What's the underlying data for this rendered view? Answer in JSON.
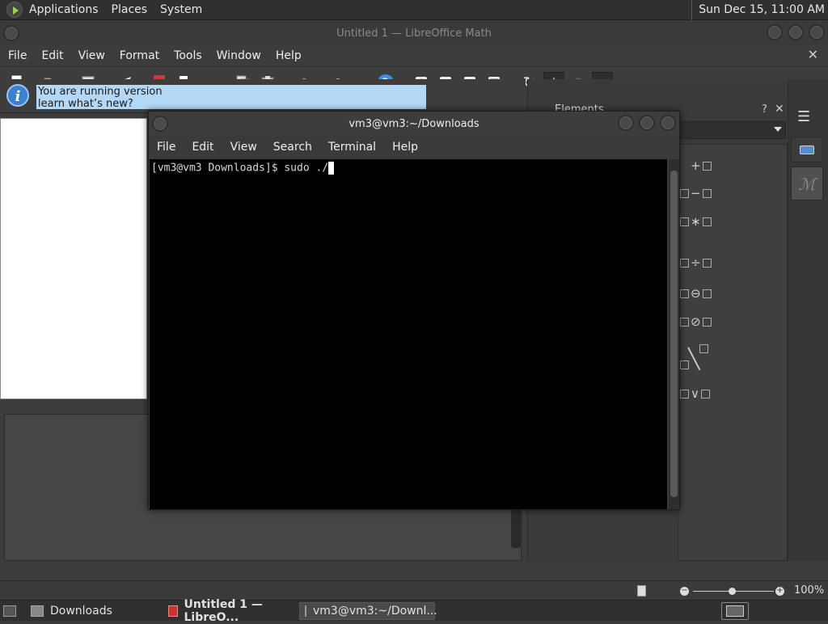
{
  "topbar": {
    "menus": [
      "Applications",
      "Places",
      "System"
    ],
    "clock": "Sun Dec 15, 11:00 AM"
  },
  "libreoffice": {
    "title": "Untitled 1 — LibreOffice Math",
    "menus": [
      "File",
      "Edit",
      "View",
      "Format",
      "Tools",
      "Window",
      "Help"
    ],
    "infobar_text_line1": "You are running version",
    "infobar_text_line2": "learn what’s new?",
    "sidebar": {
      "title": "Elements"
    },
    "zoom": "100%",
    "zoom_level_percent": 100
  },
  "elements": [
    {
      "symbol": "+",
      "label": "plus"
    },
    {
      "symbol": "−",
      "label": "minus"
    },
    {
      "symbol": "∗",
      "label": "multiply"
    },
    {
      "symbol": "÷",
      "label": "divide"
    },
    {
      "symbol": "⊖",
      "label": "circled-minus"
    },
    {
      "symbol": "⊘",
      "label": "circled-slash"
    },
    {
      "symbol": "╲",
      "label": "wideslash"
    },
    {
      "symbol": "∨",
      "label": "or"
    }
  ],
  "terminal": {
    "title": "vm3@vm3:~/Downloads",
    "menus": [
      "File",
      "Edit",
      "View",
      "Search",
      "Terminal",
      "Help"
    ],
    "prompt": "[vm3@vm3 Downloads]$ sudo ./"
  },
  "taskbar": {
    "items": [
      "Downloads",
      "Untitled 1 — LibreO...",
      "vm3@vm3:~/Downl..."
    ]
  },
  "colors": {
    "panel": "#303030",
    "window": "#3a3a3a",
    "terminal_bg": "#000000",
    "info_highlight": "#b3d8f5",
    "info_icon": "#3d7fd0"
  }
}
